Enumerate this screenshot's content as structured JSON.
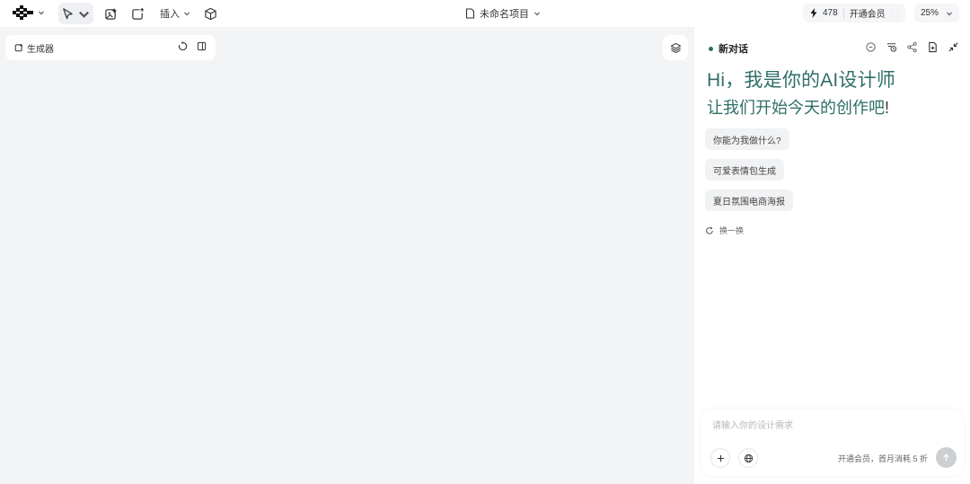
{
  "toolbar": {
    "insert_label": "插入",
    "project_name": "未命名项目",
    "credits": "478",
    "membership_label": "开通会员",
    "zoom": "25%"
  },
  "canvas": {
    "generator_label": "生成器"
  },
  "chat": {
    "title": "新对话",
    "greeting_line1": "Hi，我是你的AI设计师",
    "greeting_line2_main": "让我们开始今天的创作吧",
    "greeting_line2_tail": "!",
    "suggestions": [
      {
        "label": "你能为我做什么?"
      },
      {
        "label": "可爱表情包生成"
      },
      {
        "label": "夏日氛围电商海报"
      }
    ],
    "refresh_label": "换一换",
    "input_placeholder": "请输入你的设计需求",
    "promo_text": "开通会员，首月消耗 5 折"
  },
  "colors": {
    "accent": "#2f6e68",
    "canvas_bg": "#f3f4f6",
    "panel_bg": "#ffffff"
  }
}
